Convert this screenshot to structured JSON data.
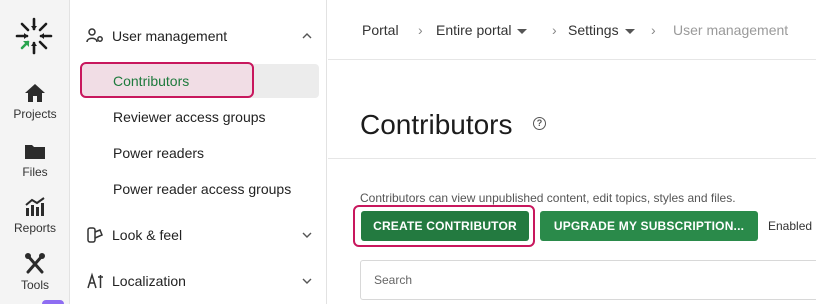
{
  "rail": {
    "items": [
      {
        "label": "Projects"
      },
      {
        "label": "Files"
      },
      {
        "label": "Reports"
      },
      {
        "label": "Tools"
      }
    ]
  },
  "sidebar": {
    "user_management": {
      "label": "User management",
      "items": [
        {
          "label": "Contributors"
        },
        {
          "label": "Reviewer access groups"
        },
        {
          "label": "Power readers"
        },
        {
          "label": "Power reader access groups"
        }
      ]
    },
    "look_feel": {
      "label": "Look & feel"
    },
    "localization": {
      "label": "Localization"
    }
  },
  "breadcrumb": {
    "items": [
      "Portal",
      "Entire portal",
      "Settings",
      "User management"
    ],
    "separator": "›"
  },
  "main": {
    "title": "Contributors",
    "help": "?",
    "description": "Contributors can view unpublished content, edit topics, styles and files.",
    "create_button": "CREATE CONTRIBUTOR",
    "upgrade_button": "UPGRADE MY SUBSCRIPTION...",
    "enabled_label": "Enabled",
    "search_placeholder": "Search"
  },
  "colors": {
    "accent_green": "#237a40",
    "highlight": "#c8175d",
    "rail_badge": "#8e6df2"
  }
}
